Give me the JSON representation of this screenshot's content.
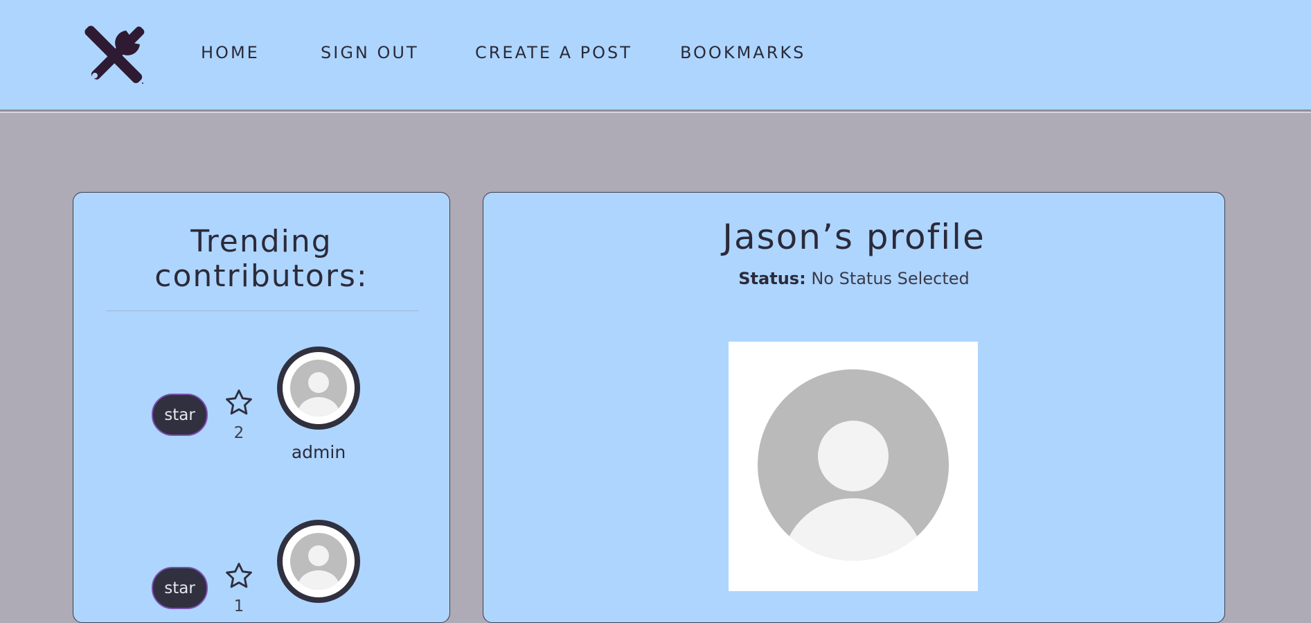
{
  "navbar": {
    "logo_icon": "tools-wrench-screwdriver-icon",
    "links": [
      {
        "label": "HOME"
      },
      {
        "label": "SIGN OUT"
      },
      {
        "label": "CREATE A POST"
      },
      {
        "label": "BOOKMARKS"
      }
    ]
  },
  "trending": {
    "title_line1": "Trending",
    "title_line2": "contributors:",
    "contributors": [
      {
        "button_label": "star",
        "star_count": "2",
        "name": "admin",
        "avatar_icon": "default-avatar-icon"
      },
      {
        "button_label": "star",
        "star_count": "1",
        "name": "",
        "avatar_icon": "default-avatar-icon"
      }
    ]
  },
  "profile": {
    "title": "Jason’s profile",
    "status_label": "Status:",
    "status_value": "No Status Selected",
    "picture_icon": "default-profile-picture-icon"
  },
  "colors": {
    "nav_background": "#aed5fd",
    "page_background": "#aeabb6",
    "card_background": "#aed5fd",
    "dark": "#30303f",
    "button_border": "#7a4fb0"
  }
}
